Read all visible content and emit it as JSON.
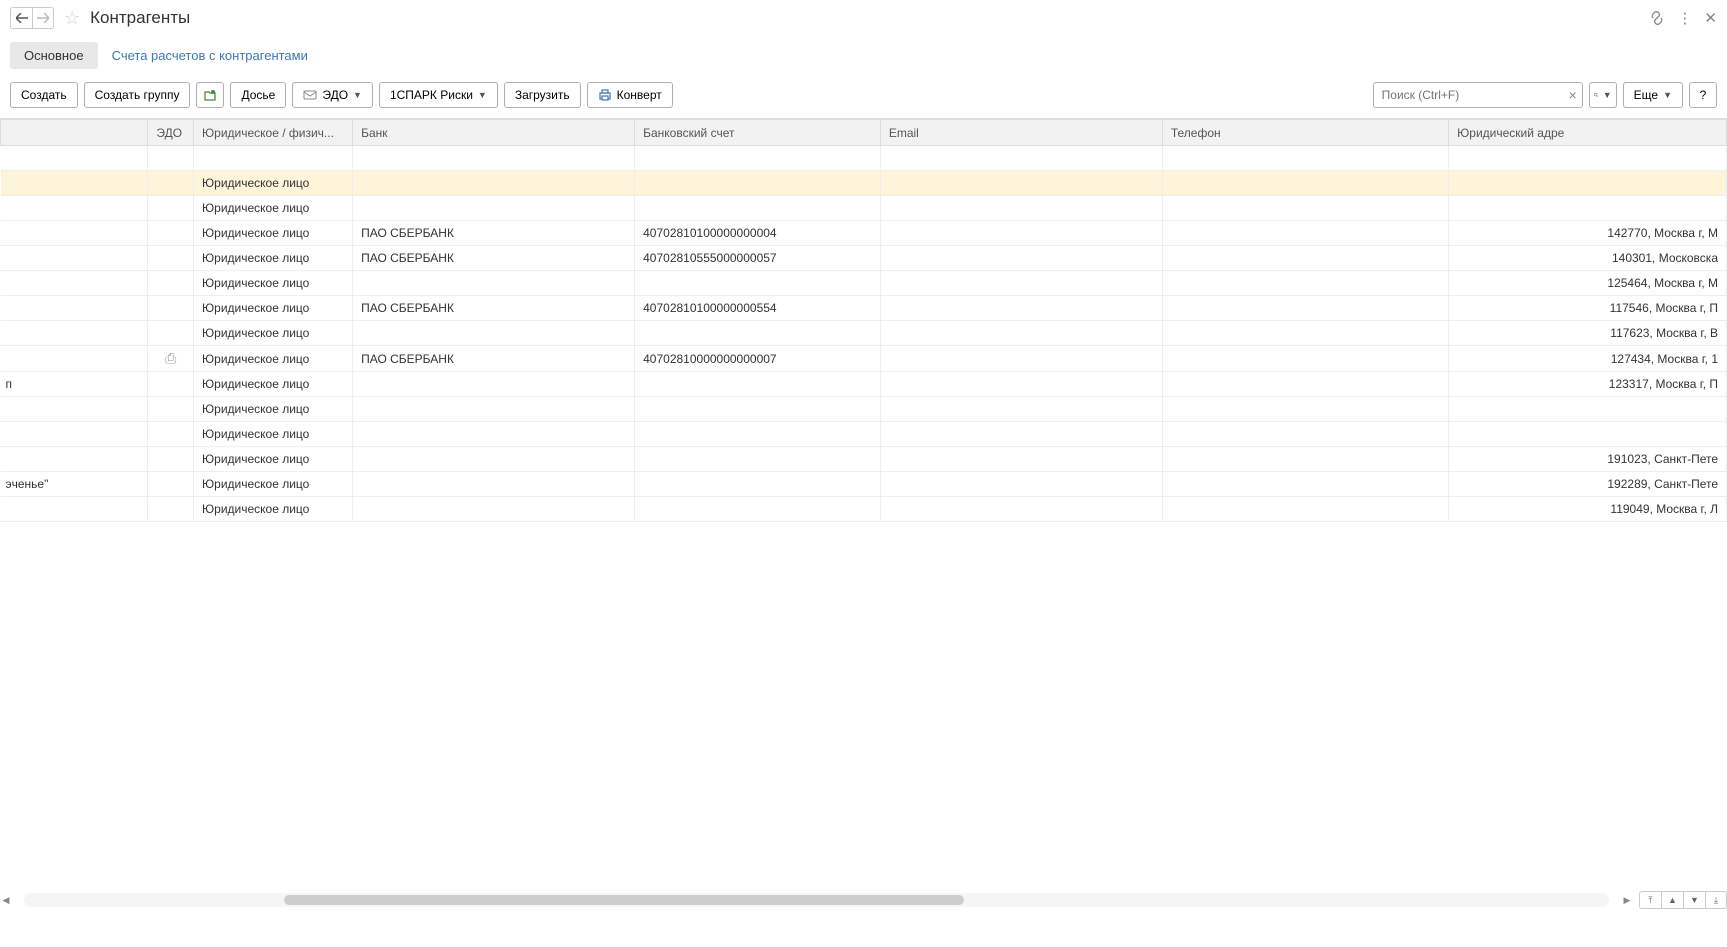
{
  "header": {
    "title": "Контрагенты"
  },
  "tabs": {
    "main": "Основное",
    "accounts": "Счета расчетов с контрагентами"
  },
  "toolbar": {
    "create": "Создать",
    "create_group": "Создать группу",
    "dossier": "Досье",
    "edo": "ЭДО",
    "spark": "1СПАРК Риски",
    "upload": "Загрузить",
    "envelope": "Конверт",
    "search_placeholder": "Поиск (Ctrl+F)",
    "more": "Еще",
    "help": "?"
  },
  "columns": {
    "name": "",
    "edo": "ЭДО",
    "type": "Юридическое / физич...",
    "bank": "Банк",
    "account": "Банковский счет",
    "email": "Email",
    "phone": "Телефон",
    "address": "Юридический адре"
  },
  "rows": [
    {
      "name": "",
      "edo": "",
      "type": "Юридическое лицо",
      "bank": "",
      "account": "",
      "email": "",
      "phone": "",
      "address": "",
      "highlight": true
    },
    {
      "name": "",
      "edo": "",
      "type": "Юридическое лицо",
      "bank": "",
      "account": "",
      "email": "",
      "phone": "",
      "address": ""
    },
    {
      "name": "",
      "edo": "",
      "type": "Юридическое лицо",
      "bank": "ПАО СБЕРБАНК",
      "account": "40702810100000000004",
      "email": "",
      "phone": "",
      "address": "142770, Москва г, М"
    },
    {
      "name": "",
      "edo": "",
      "type": "Юридическое лицо",
      "bank": "ПАО СБЕРБАНК",
      "account": "40702810555000000057",
      "email": "",
      "phone": "",
      "address": "140301, Московска"
    },
    {
      "name": "",
      "edo": "",
      "type": "Юридическое лицо",
      "bank": "",
      "account": "",
      "email": "",
      "phone": "",
      "address": "125464, Москва г, М"
    },
    {
      "name": "",
      "edo": "",
      "type": "Юридическое лицо",
      "bank": "ПАО СБЕРБАНК",
      "account": "40702810100000000554",
      "email": "",
      "phone": "",
      "address": "117546, Москва г, П"
    },
    {
      "name": "",
      "edo": "",
      "type": "Юридическое лицо",
      "bank": "",
      "account": "",
      "email": "",
      "phone": "",
      "address": "117623, Москва г, В"
    },
    {
      "name": "",
      "edo": "printer",
      "type": "Юридическое лицо",
      "bank": "ПАО СБЕРБАНК",
      "account": "40702810000000000007",
      "email": "",
      "phone": "",
      "address": "127434, Москва г, 1"
    },
    {
      "name": "п",
      "edo": "",
      "type": "Юридическое лицо",
      "bank": "",
      "account": "",
      "email": "",
      "phone": "",
      "address": "123317, Москва г, П"
    },
    {
      "name": "",
      "edo": "",
      "type": "Юридическое лицо",
      "bank": "",
      "account": "",
      "email": "",
      "phone": "",
      "address": ""
    },
    {
      "name": "",
      "edo": "",
      "type": "Юридическое лицо",
      "bank": "",
      "account": "",
      "email": "",
      "phone": "",
      "address": ""
    },
    {
      "name": "",
      "edo": "",
      "type": "Юридическое лицо",
      "bank": "",
      "account": "",
      "email": "",
      "phone": "",
      "address": "191023, Санкт-Пете"
    },
    {
      "name": "эченье\"",
      "edo": "",
      "type": "Юридическое лицо",
      "bank": "",
      "account": "",
      "email": "",
      "phone": "",
      "address": "192289, Санкт-Пете"
    },
    {
      "name": "",
      "edo": "",
      "type": "Юридическое лицо",
      "bank": "",
      "account": "",
      "email": "",
      "phone": "",
      "address": "119049, Москва г, Л"
    }
  ]
}
